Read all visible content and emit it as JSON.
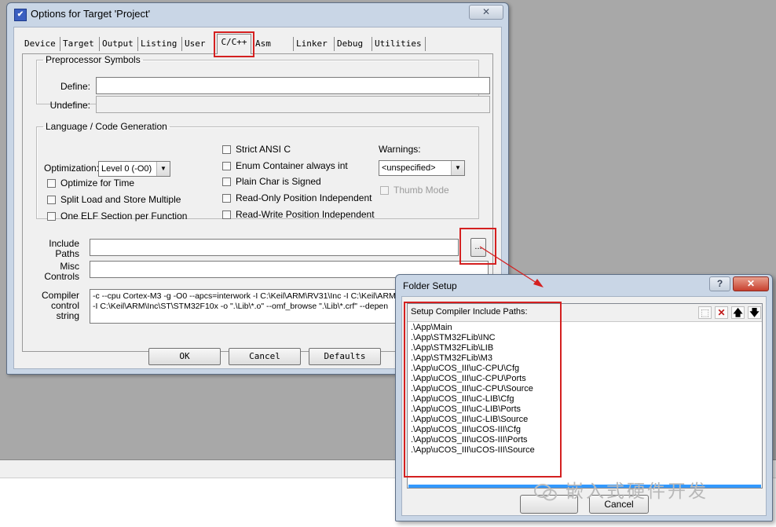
{
  "main_dialog": {
    "title": "Options for Target 'Project'",
    "close_label": "✕",
    "tabs": [
      "Device",
      "Target",
      "Output",
      "Listing",
      "User",
      "C/C++",
      "Asm",
      "Linker",
      "Debug",
      "Utilities"
    ],
    "active_tab": "C/C++",
    "preprocessor": {
      "legend": "Preprocessor Symbols",
      "define_label": "Define:",
      "define_value": "",
      "undefine_label": "Undefine:",
      "undefine_value": ""
    },
    "language": {
      "legend": "Language / Code Generation",
      "optimization_label": "Optimization:",
      "optimization_value": "Level 0 (-O0)",
      "warnings_label": "Warnings:",
      "warnings_value": "<unspecified>",
      "options": {
        "optimize_for_time": "Optimize for Time",
        "split_load_store": "Split Load and Store Multiple",
        "one_elf_section": "One ELF Section per Function",
        "strict_ansi": "Strict ANSI C",
        "enum_container": "Enum Container always int",
        "plain_char_signed": "Plain Char is Signed",
        "ro_pos_independent": "Read-Only Position Independent",
        "rw_pos_independent": "Read-Write Position Independent",
        "thumb_mode": "Thumb Mode"
      }
    },
    "include_paths_label_1": "Include",
    "include_paths_label_2": "Paths",
    "include_paths_value": "",
    "browse_label": "...",
    "misc_label_1": "Misc",
    "misc_label_2": "Controls",
    "misc_value": "",
    "compiler_label_1": "Compiler",
    "compiler_label_2": "control",
    "compiler_label_3": "string",
    "compiler_line_1": "-c --cpu Cortex-M3 -g -O0 --apcs=interwork -I C:\\Keil\\ARM\\RV31\\Inc -I C:\\Keil\\ARM",
    "compiler_line_2": "-I C:\\Keil\\ARM\\Inc\\ST\\STM32F10x -o \".\\Lib\\*.o\" --omf_browse \".\\Lib\\*.crf\" --depen",
    "buttons": {
      "ok": "OK",
      "cancel": "Cancel",
      "defaults": "Defaults"
    }
  },
  "folder_dialog": {
    "title": "Folder Setup",
    "help_label": "?",
    "close_label": "✕",
    "header": "Setup Compiler Include Paths:",
    "paths": [
      ".\\App\\Main",
      ".\\App\\STM32FLib\\INC",
      ".\\App\\STM32FLib\\LIB",
      ".\\App\\STM32FLib\\M3",
      ".\\App\\uCOS_III\\uC-CPU\\Cfg",
      ".\\App\\uCOS_III\\uC-CPU\\Ports",
      ".\\App\\uCOS_III\\uC-CPU\\Source",
      ".\\App\\uCOS_III\\uC-LIB\\Cfg",
      ".\\App\\uCOS_III\\uC-LIB\\Ports",
      ".\\App\\uCOS_III\\uC-LIB\\Source",
      ".\\App\\uCOS_III\\uCOS-III\\Cfg",
      ".\\App\\uCOS_III\\uCOS-III\\Ports",
      ".\\App\\uCOS_III\\uCOS-III\\Source"
    ],
    "cancel_label": "Cancel"
  },
  "watermark": "嵌入式硬件开发",
  "colors": {
    "highlight": "#d42020",
    "selection": "#3399ff",
    "dialog_frame": "#c9d6e6"
  }
}
